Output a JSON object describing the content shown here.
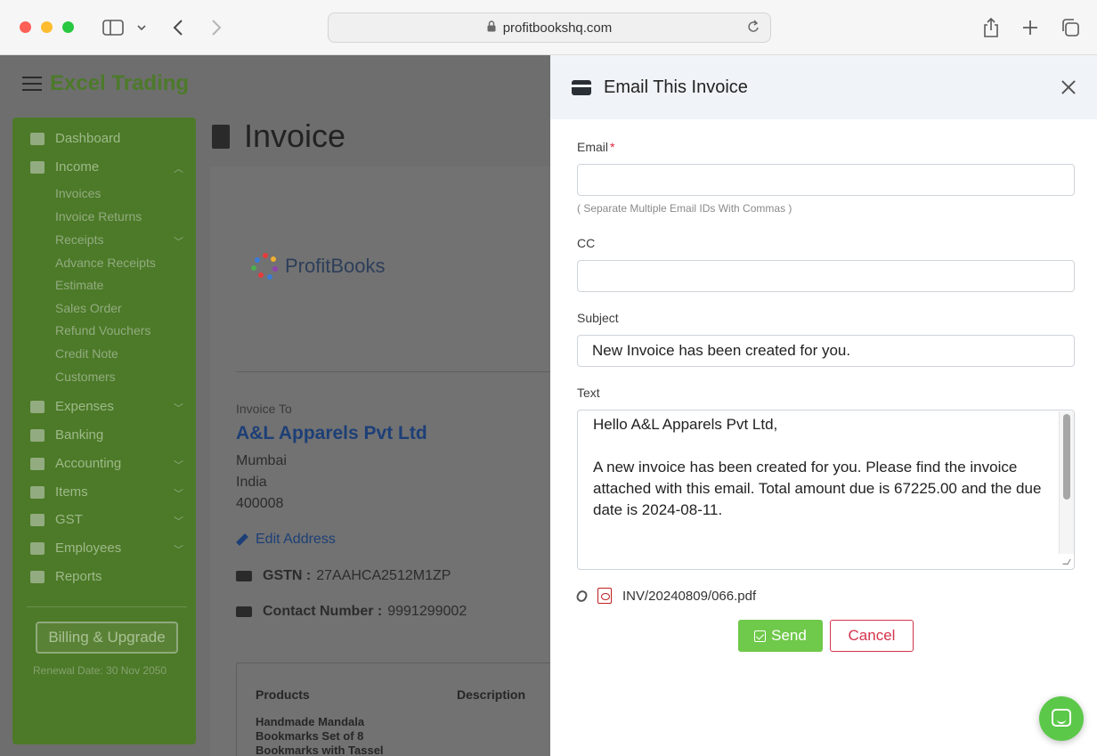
{
  "browser": {
    "url": "profitbookshq.com"
  },
  "app": {
    "brand": "Excel Trading",
    "page_title": "Invoice"
  },
  "sidebar": {
    "items": [
      {
        "label": "Dashboard",
        "icon": "dashboard-icon"
      },
      {
        "label": "Income",
        "icon": "money-icon"
      },
      {
        "label": "Expenses",
        "icon": "card-icon"
      },
      {
        "label": "Banking",
        "icon": "bank-icon"
      },
      {
        "label": "Accounting",
        "icon": "book-icon"
      },
      {
        "label": "Items",
        "icon": "tag-icon"
      },
      {
        "label": "GST",
        "icon": "rupee-icon"
      },
      {
        "label": "Employees",
        "icon": "users-icon"
      },
      {
        "label": "Reports",
        "icon": "chart-icon"
      }
    ],
    "income_sub": [
      "Invoices",
      "Invoice Returns",
      "Receipts",
      "Advance Receipts",
      "Estimate",
      "Sales Order",
      "Refund Vouchers",
      "Credit Note",
      "Customers"
    ],
    "billing_label": "Billing & Upgrade",
    "renewal": "Renewal Date: 30 Nov 2050"
  },
  "invoice": {
    "logo_text": "ProfitBooks",
    "invoice_to_label": "Invoice To",
    "customer": "A&L Apparels Pvt Ltd",
    "city": "Mumbai",
    "country": "India",
    "pin": "400008",
    "edit_address": "Edit Address",
    "gstn_label": "GSTN :",
    "gstn_value": "27AAHCA2512M1ZP",
    "contact_label": "Contact Number :",
    "contact_value": "9991299002",
    "col_products": "Products",
    "col_description": "Description",
    "first_product": "Handmade Mandala Bookmarks Set of 8 Bookmarks with Tassel"
  },
  "modal": {
    "title": "Email This Invoice",
    "email_label": "Email",
    "email_required": "*",
    "email_value": "",
    "email_hint": "( Separate Multiple Email IDs With Commas )",
    "cc_label": "CC",
    "cc_value": "",
    "subject_label": "Subject",
    "subject_value": "New Invoice has been created for you.",
    "text_label": "Text",
    "text_value": "Hello A&L Apparels Pvt Ltd,\n\nA new invoice has been created for you. Please find the invoice attached with this email. Total amount due is 67225.00 and the due date is 2024-08-11.",
    "attachment": "INV/20240809/066.pdf",
    "send_label": "Send",
    "cancel_label": "Cancel"
  },
  "colors": {
    "accent_green": "#6fc94a",
    "cancel_red": "#d4344b",
    "brand_blue": "#1d3f77"
  }
}
